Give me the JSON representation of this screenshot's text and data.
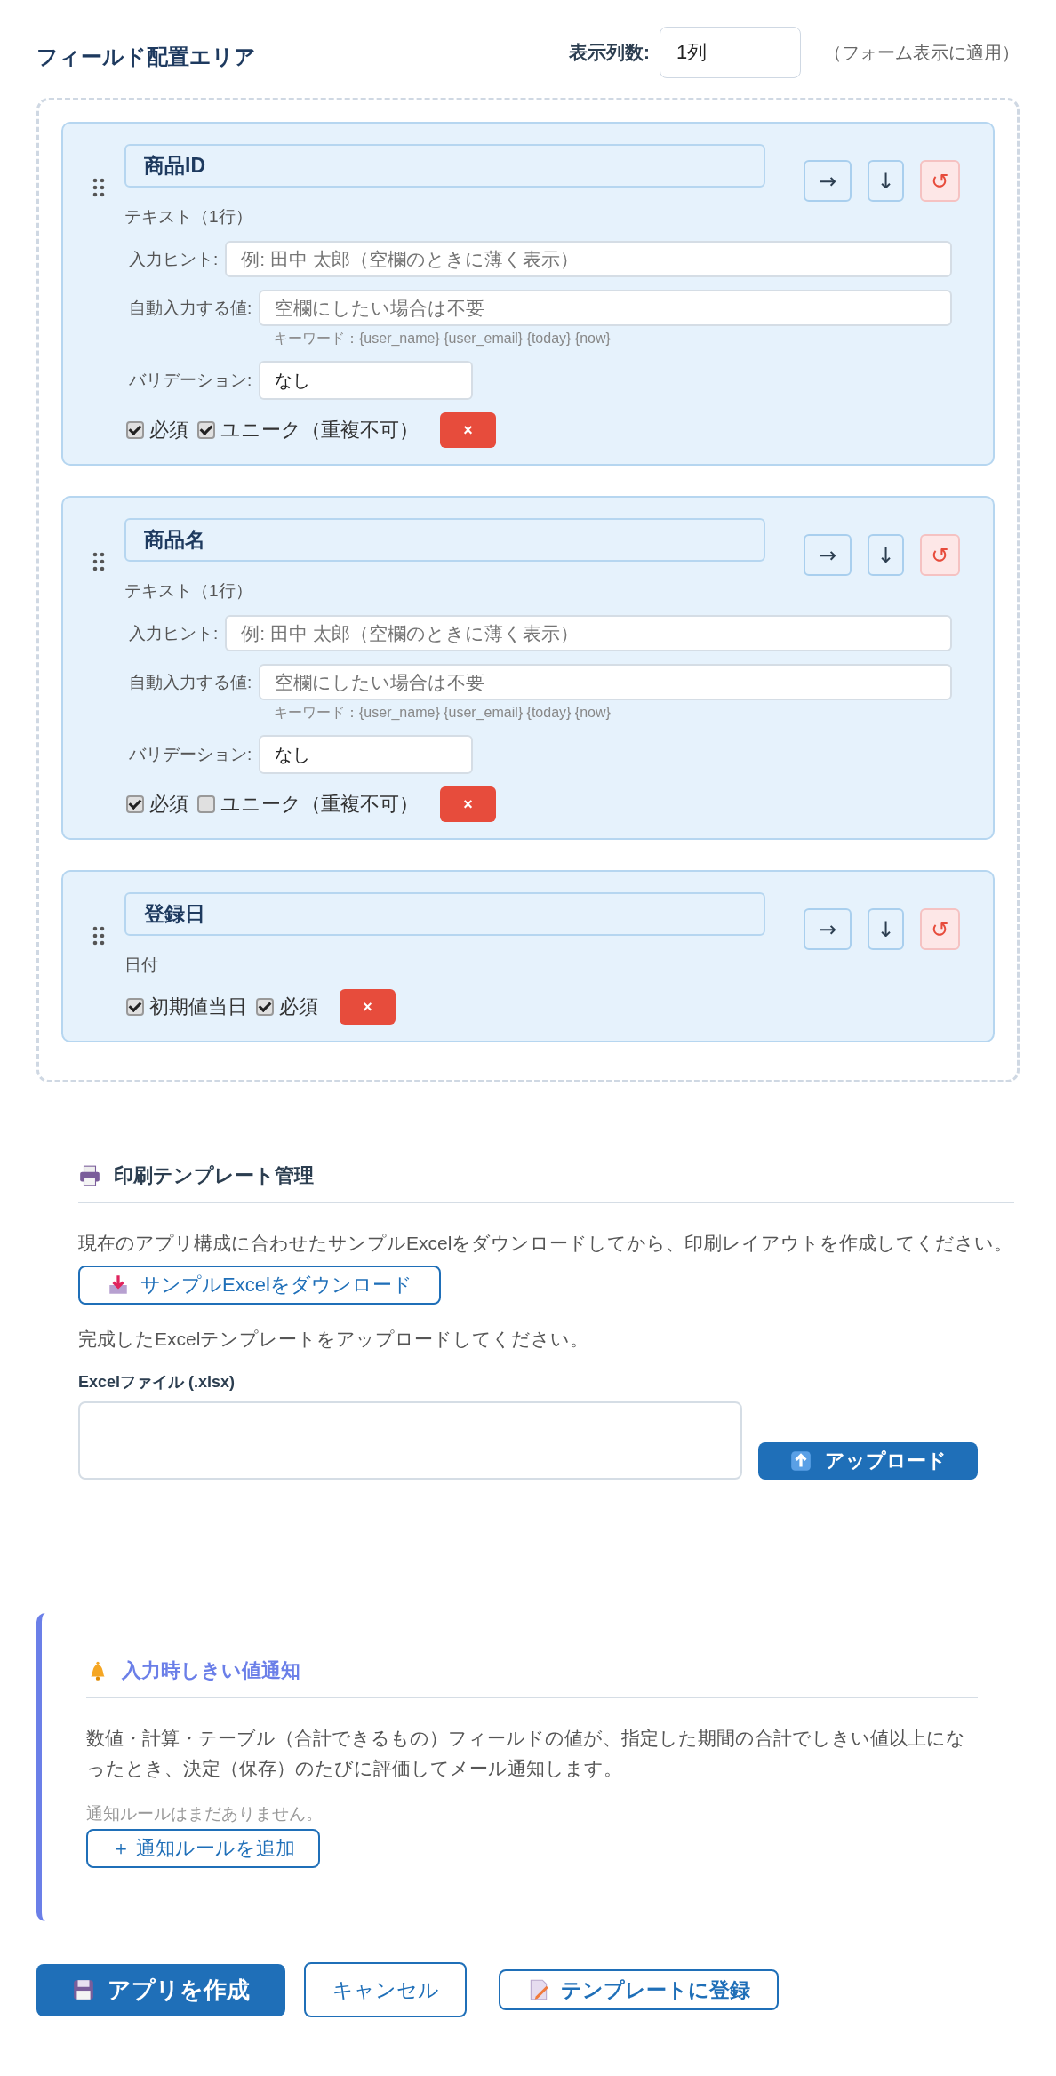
{
  "layout": {
    "title": "フィールド配置エリア",
    "columns_label": "表示列数:",
    "columns_value": "1列",
    "columns_note": "（フォーム表示に適用）"
  },
  "fields": [
    {
      "kind": "text",
      "name": "商品ID",
      "type_label": "テキスト（1行）",
      "move_right": "→",
      "move_down": "↓",
      "reset": "↺",
      "hint_label": "入力ヒント:",
      "hint_placeholder": "例: 田中 太郎（空欄のときに薄く表示）",
      "default_label": "自動入力する値:",
      "default_placeholder": "空欄にしたい場合は不要",
      "keywords": "キーワード：{user_name} {user_email} {today} {now}",
      "validation_label": "バリデーション:",
      "validation_value": "なし",
      "options": [
        {
          "label": "必須",
          "checked": true
        },
        {
          "label": "ユニーク（重複不可）",
          "checked": true
        }
      ],
      "delete": "×"
    },
    {
      "kind": "text",
      "name": "商品名",
      "type_label": "テキスト（1行）",
      "move_right": "→",
      "move_down": "↓",
      "reset": "↺",
      "hint_label": "入力ヒント:",
      "hint_placeholder": "例: 田中 太郎（空欄のときに薄く表示）",
      "default_label": "自動入力する値:",
      "default_placeholder": "空欄にしたい場合は不要",
      "keywords": "キーワード：{user_name} {user_email} {today} {now}",
      "validation_label": "バリデーション:",
      "validation_value": "なし",
      "options": [
        {
          "label": "必須",
          "checked": true
        },
        {
          "label": "ユニーク（重複不可）",
          "checked": false
        }
      ],
      "delete": "×"
    },
    {
      "kind": "date",
      "name": "登録日",
      "type_label": "日付",
      "move_right": "→",
      "move_down": "↓",
      "reset": "↺",
      "options": [
        {
          "label": "初期値当日",
          "checked": true
        },
        {
          "label": "必須",
          "checked": true
        }
      ],
      "delete": "×"
    }
  ],
  "print_template": {
    "title": "印刷テンプレート管理",
    "description": "現在のアプリ構成に合わせたサンプルExcelをダウンロードしてから、印刷レイアウトを作成してください。",
    "download_button": "サンプルExcelをダウンロード",
    "upload_description": "完成したExcelテンプレートをアップロードしてください。",
    "file_label": "Excelファイル (.xlsx)",
    "upload_button": "アップロード"
  },
  "threshold_notification": {
    "title": "入力時しきい値通知",
    "description": "数値・計算・テーブル（合計できるもの）フィールドの値が、指定した期間の合計でしきい値以上になったとき、決定（保存）のたびに評価してメール通知します。",
    "empty_text": "通知ルールはまだありません。",
    "add_button": "＋ 通知ルールを追加"
  },
  "actions": {
    "create": "アプリを作成",
    "cancel": "キャンセル",
    "register_template": "テンプレートに登録"
  }
}
